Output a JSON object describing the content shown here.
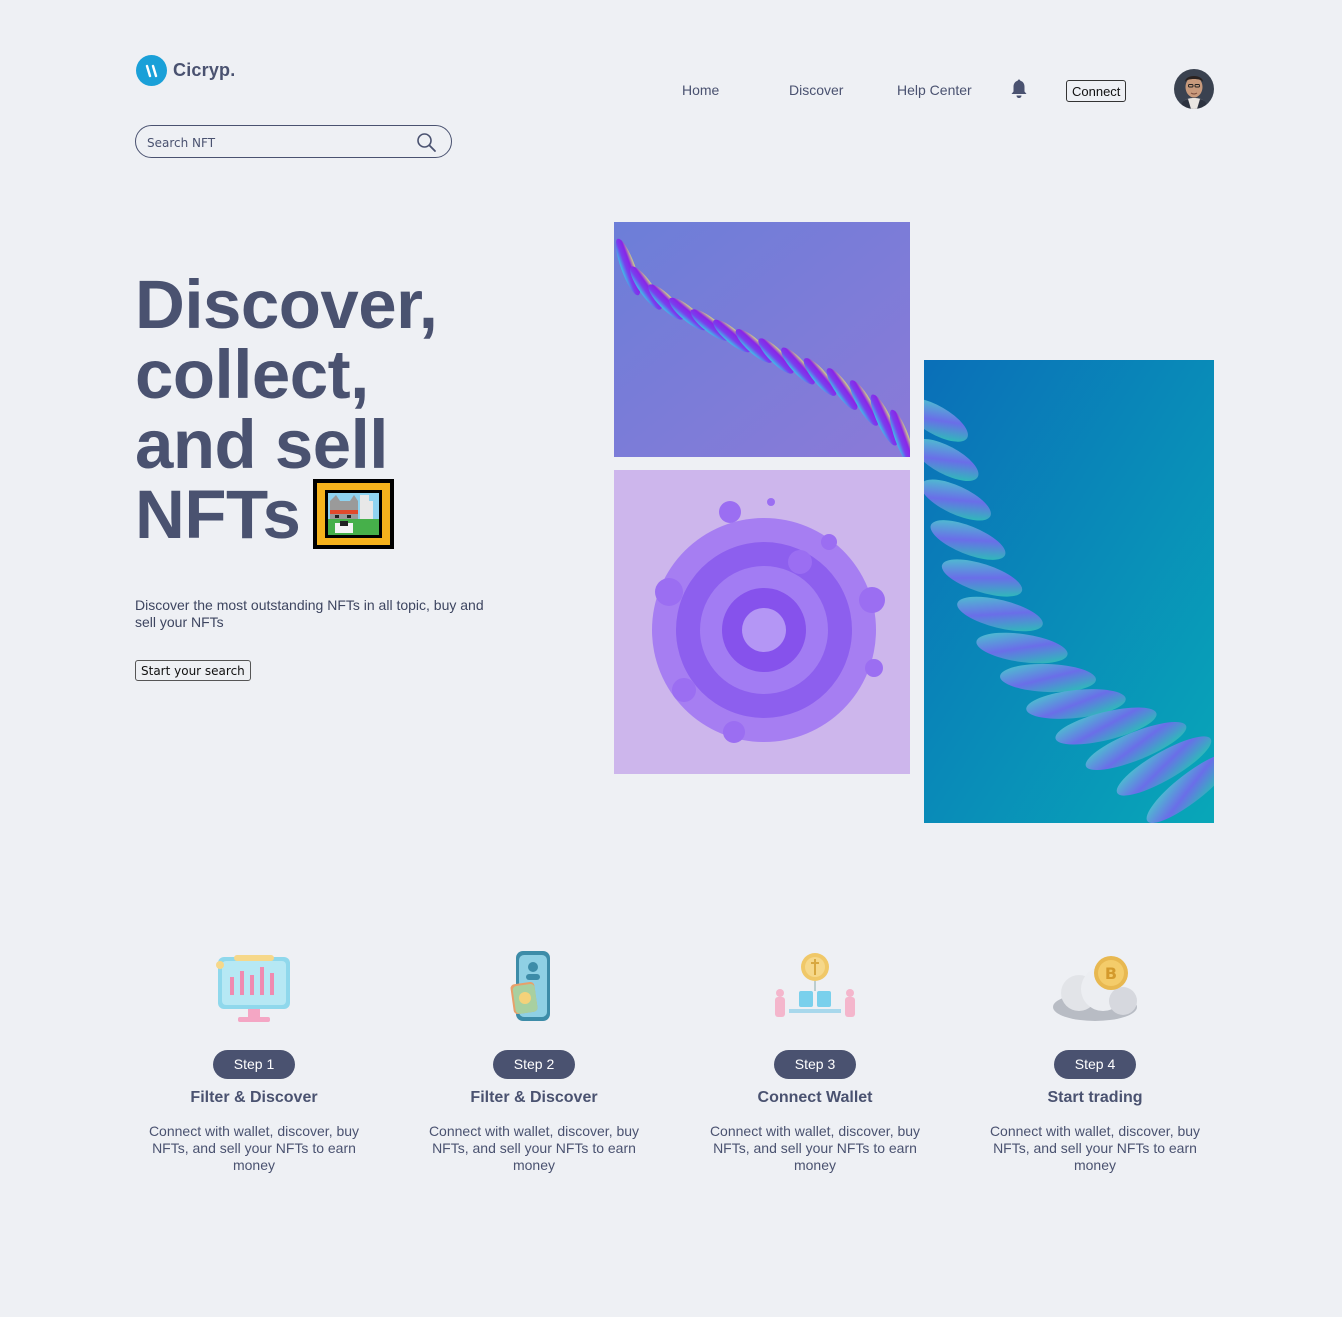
{
  "brand": {
    "name": "Cicryp."
  },
  "nav": {
    "home": "Home",
    "discover": "Discover",
    "help": "Help Center",
    "connect": "Connect"
  },
  "search": {
    "placeholder": "Search NFT"
  },
  "hero": {
    "title_lines": [
      "Discover,",
      "collect,",
      "and sell",
      "NFTs"
    ],
    "subtitle": "Discover the most outstanding NFTs in all topic, buy and sell your NFTs",
    "cta": "Start your search"
  },
  "steps": [
    {
      "badge": "Step 1",
      "title": "Filter & Discover",
      "desc": "Connect with wallet, discover, buy NFTs, and sell your NFTs to earn money",
      "icon": "monitor-chart-icon"
    },
    {
      "badge": "Step 2",
      "title": "Filter & Discover",
      "desc": "Connect with wallet, discover, buy NFTs, and sell your NFTs to earn money",
      "icon": "phone-wallet-icon"
    },
    {
      "badge": "Step 3",
      "title": "Connect Wallet",
      "desc": "Connect with wallet, discover, buy NFTs, and sell your NFTs to earn money",
      "icon": "coin-network-icon"
    },
    {
      "badge": "Step 4",
      "title": "Start trading",
      "desc": "Connect with wallet, discover, buy NFTs, and sell your NFTs to earn money",
      "icon": "bitcoin-cloud-icon"
    }
  ],
  "colors": {
    "text": "#4a5270",
    "background": "#eef0f4",
    "brand": "#1aa0d8"
  }
}
